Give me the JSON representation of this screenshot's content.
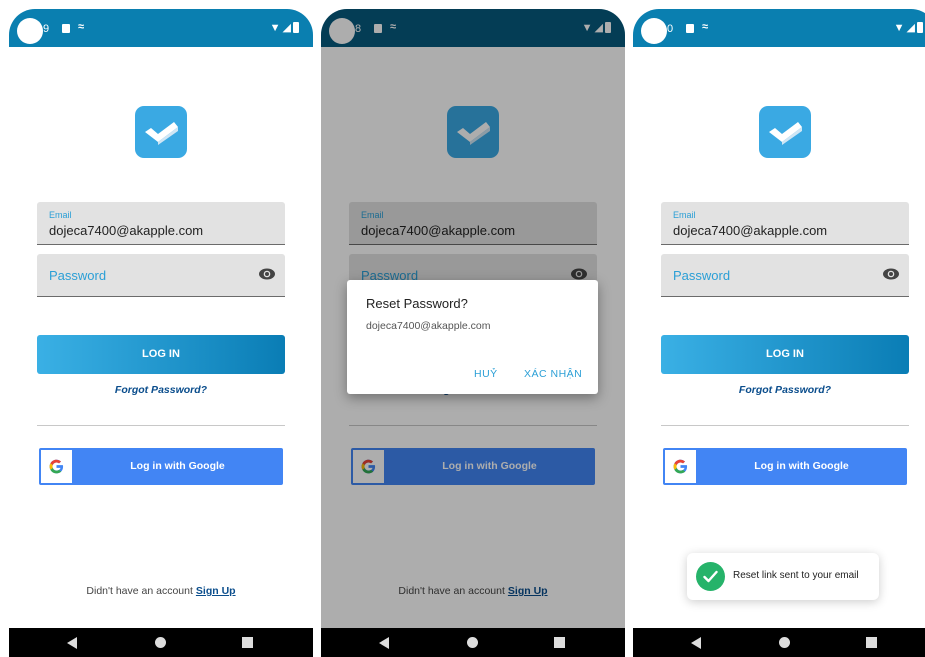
{
  "status_bar": {
    "times": [
      "9",
      "8",
      "0"
    ],
    "icon_names": [
      "notification-icon",
      "sync-icon",
      "wifi-icon",
      "signal-icon",
      "battery-icon"
    ]
  },
  "login": {
    "email_label": "Email",
    "email_value": "dojeca7400@akapple.com",
    "password_placeholder": "Password",
    "login_button": "LOG IN",
    "forgot_password": "Forgot Password?",
    "google_button": "Log in with Google",
    "signup_prompt": "Didn't have an account",
    "signup_link": "Sign Up"
  },
  "dialog": {
    "title": "Reset Password?",
    "message": "dojeca7400@akapple.com",
    "cancel": "HUỶ",
    "confirm": "XÁC NHẬN"
  },
  "toast": {
    "message": "Reset link sent to your email"
  },
  "colors": {
    "status_bar": "#0a7fb0",
    "accent": "#2b9fd6",
    "google_blue": "#4285f4",
    "success": "#26b36a",
    "link": "#0a4d8c"
  }
}
